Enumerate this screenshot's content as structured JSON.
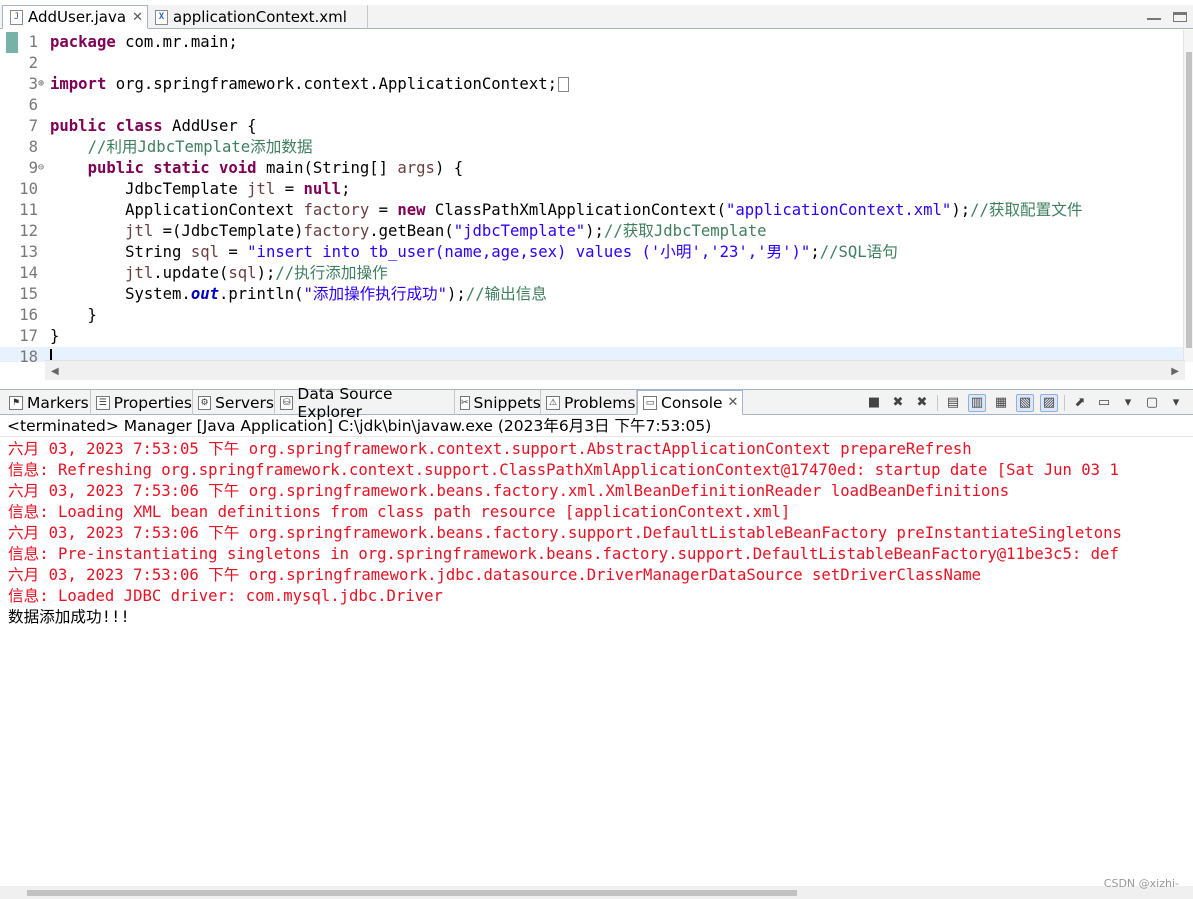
{
  "editor": {
    "tabs": [
      {
        "label": "AddUser.java",
        "icon": "java-file-icon",
        "active": true
      },
      {
        "label": "applicationContext.xml",
        "icon": "xml-file-icon",
        "active": false
      }
    ],
    "code_lines": [
      {
        "num": "1",
        "fold": "",
        "segments": [
          {
            "t": "kw",
            "v": "package"
          },
          {
            "t": "",
            "v": " com.mr.main;"
          }
        ]
      },
      {
        "num": "2",
        "fold": "",
        "segments": []
      },
      {
        "num": "3",
        "fold": "⊕",
        "segments": [
          {
            "t": "kw",
            "v": "import"
          },
          {
            "t": "",
            "v": " org.springframework.context.ApplicationContext;"
          },
          {
            "t": "box",
            "v": ""
          }
        ]
      },
      {
        "num": "6",
        "fold": "",
        "segments": []
      },
      {
        "num": "7",
        "fold": "",
        "segments": [
          {
            "t": "kw",
            "v": "public class"
          },
          {
            "t": "",
            "v": " AddUser {"
          }
        ]
      },
      {
        "num": "8",
        "fold": "",
        "segments": [
          {
            "t": "",
            "v": "    "
          },
          {
            "t": "cmt",
            "v": "//利用JdbcTemplate添加数据"
          }
        ]
      },
      {
        "num": "9",
        "fold": "⊖",
        "segments": [
          {
            "t": "",
            "v": "    "
          },
          {
            "t": "kw",
            "v": "public static void"
          },
          {
            "t": "",
            "v": " main(String[] "
          },
          {
            "t": "var",
            "v": "args"
          },
          {
            "t": "",
            "v": ") {"
          }
        ]
      },
      {
        "num": "10",
        "fold": "",
        "segments": [
          {
            "t": "",
            "v": "        JdbcTemplate "
          },
          {
            "t": "var",
            "v": "jtl"
          },
          {
            "t": "",
            "v": " = "
          },
          {
            "t": "kw",
            "v": "null"
          },
          {
            "t": "",
            "v": ";"
          }
        ]
      },
      {
        "num": "11",
        "fold": "",
        "segments": [
          {
            "t": "",
            "v": "        ApplicationContext "
          },
          {
            "t": "var",
            "v": "factory"
          },
          {
            "t": "",
            "v": " = "
          },
          {
            "t": "kw",
            "v": "new"
          },
          {
            "t": "",
            "v": " ClassPathXmlApplicationContext("
          },
          {
            "t": "str",
            "v": "\"applicationContext.xml\""
          },
          {
            "t": "",
            "v": ");"
          },
          {
            "t": "cmt",
            "v": "//获取配置文件"
          }
        ]
      },
      {
        "num": "12",
        "fold": "",
        "segments": [
          {
            "t": "",
            "v": "        "
          },
          {
            "t": "var",
            "v": "jtl"
          },
          {
            "t": "",
            "v": " =(JdbcTemplate)"
          },
          {
            "t": "var",
            "v": "factory"
          },
          {
            "t": "",
            "v": ".getBean("
          },
          {
            "t": "str",
            "v": "\"jdbcTemplate\""
          },
          {
            "t": "",
            "v": ");"
          },
          {
            "t": "cmt",
            "v": "//获取JdbcTemplate"
          }
        ]
      },
      {
        "num": "13",
        "fold": "",
        "segments": [
          {
            "t": "",
            "v": "        String "
          },
          {
            "t": "var",
            "v": "sql"
          },
          {
            "t": "",
            "v": " = "
          },
          {
            "t": "str",
            "v": "\"insert into tb_user(name,age,sex) values ('小明','23','男')\""
          },
          {
            "t": "",
            "v": ";"
          },
          {
            "t": "cmt",
            "v": "//SQL语句"
          }
        ]
      },
      {
        "num": "14",
        "fold": "",
        "segments": [
          {
            "t": "",
            "v": "        "
          },
          {
            "t": "var",
            "v": "jtl"
          },
          {
            "t": "",
            "v": ".update("
          },
          {
            "t": "var",
            "v": "sql"
          },
          {
            "t": "",
            "v": ");"
          },
          {
            "t": "cmt",
            "v": "//执行添加操作"
          }
        ]
      },
      {
        "num": "15",
        "fold": "",
        "segments": [
          {
            "t": "",
            "v": "        System."
          },
          {
            "t": "fld",
            "v": "out"
          },
          {
            "t": "",
            "v": ".println("
          },
          {
            "t": "str",
            "v": "\"添加操作执行成功\""
          },
          {
            "t": "",
            "v": ");"
          },
          {
            "t": "cmt",
            "v": "//输出信息"
          }
        ]
      },
      {
        "num": "16",
        "fold": "",
        "segments": [
          {
            "t": "",
            "v": "    }"
          }
        ]
      },
      {
        "num": "17",
        "fold": "",
        "segments": [
          {
            "t": "",
            "v": "}"
          }
        ]
      },
      {
        "num": "18",
        "fold": "",
        "segments": [
          {
            "t": "caret",
            "v": ""
          }
        ],
        "current": true
      }
    ]
  },
  "views": {
    "tabs": [
      {
        "label": "Markers",
        "icon": "markers-icon",
        "active": false
      },
      {
        "label": "Properties",
        "icon": "properties-icon",
        "active": false
      },
      {
        "label": "Servers",
        "icon": "servers-icon",
        "active": false
      },
      {
        "label": "Data Source Explorer",
        "icon": "data-source-explorer-icon",
        "active": false
      },
      {
        "label": "Snippets",
        "icon": "snippets-icon",
        "active": false
      },
      {
        "label": "Problems",
        "icon": "problems-icon",
        "active": false
      },
      {
        "label": "Console",
        "icon": "console-icon",
        "active": true
      }
    ],
    "toolbar": [
      {
        "name": "terminate-icon",
        "glyph": "■"
      },
      {
        "name": "remove-launch-icon",
        "glyph": "✖"
      },
      {
        "name": "remove-all-terminated-icon",
        "glyph": "✖"
      },
      {
        "name": "sep"
      },
      {
        "name": "clear-console-icon",
        "glyph": "▤"
      },
      {
        "name": "scroll-lock-icon",
        "glyph": "▥",
        "pressed": true
      },
      {
        "name": "word-wrap-icon",
        "glyph": "▦"
      },
      {
        "name": "show-on-stdout-icon",
        "glyph": "▧",
        "pressed": true
      },
      {
        "name": "show-on-stderr-icon",
        "glyph": "▨",
        "pressed": true
      },
      {
        "name": "sep"
      },
      {
        "name": "pin-console-icon",
        "glyph": "⬈"
      },
      {
        "name": "display-selected-console-icon",
        "glyph": "▭"
      },
      {
        "name": "display-dropdown-icon",
        "glyph": "▾"
      },
      {
        "name": "open-console-icon",
        "glyph": "▢"
      },
      {
        "name": "open-console-dropdown-icon",
        "glyph": "▾"
      }
    ]
  },
  "console": {
    "header": "<terminated> Manager [Java Application] C:\\jdk\\bin\\javaw.exe (2023年6月3日 下午7:53:05)",
    "lines": [
      {
        "type": "err",
        "text": "六月 03, 2023 7:53:05 下午 org.springframework.context.support.AbstractApplicationContext prepareRefresh"
      },
      {
        "type": "err",
        "text": "信息: Refreshing org.springframework.context.support.ClassPathXmlApplicationContext@17470ed: startup date [Sat Jun 03 1"
      },
      {
        "type": "err",
        "text": "六月 03, 2023 7:53:06 下午 org.springframework.beans.factory.xml.XmlBeanDefinitionReader loadBeanDefinitions"
      },
      {
        "type": "err",
        "text": "信息: Loading XML bean definitions from class path resource [applicationContext.xml]"
      },
      {
        "type": "err",
        "text": "六月 03, 2023 7:53:06 下午 org.springframework.beans.factory.support.DefaultListableBeanFactory preInstantiateSingletons"
      },
      {
        "type": "err",
        "text": "信息: Pre-instantiating singletons in org.springframework.beans.factory.support.DefaultListableBeanFactory@11be3c5: def"
      },
      {
        "type": "err",
        "text": "六月 03, 2023 7:53:06 下午 org.springframework.jdbc.datasource.DriverManagerDataSource setDriverClassName"
      },
      {
        "type": "err",
        "text": "信息: Loaded JDBC driver: com.mysql.jdbc.Driver"
      },
      {
        "type": "out",
        "text": "数据添加成功!!!"
      }
    ]
  },
  "watermark": "CSDN @xizhi-",
  "colors": {
    "keyword": "#7f0055",
    "string": "#2a00ff",
    "comment": "#3f7f5f",
    "stderr": "#e81123",
    "current_line": "#e8f2fe"
  }
}
